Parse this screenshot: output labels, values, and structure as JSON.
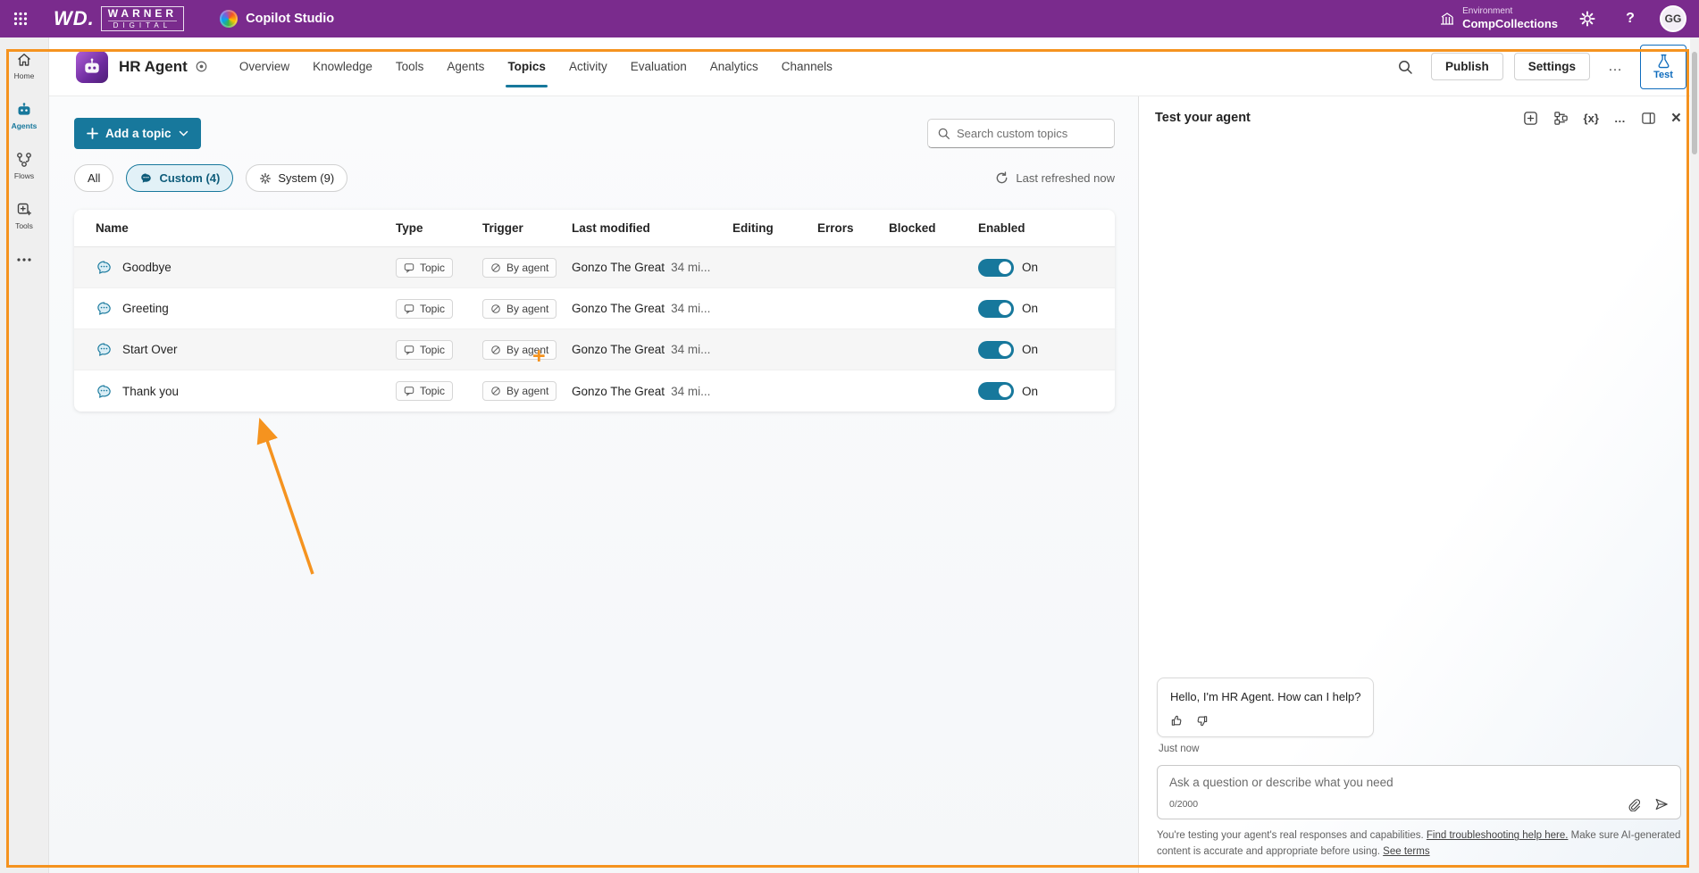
{
  "colors": {
    "topbar_purple": "#7a2b8d",
    "accent_teal": "#17789c",
    "action_blue": "#0f6cbd",
    "annotation_orange": "#f5931f"
  },
  "topbar": {
    "brand_wd": "WD.",
    "brand_warner": "WARNER",
    "brand_digital": "DIGITAL",
    "app_name": "Copilot Studio",
    "environment_label": "Environment",
    "environment_name": "CompCollections",
    "help_label": "?",
    "avatar_initials": "GG"
  },
  "rail": {
    "items": [
      {
        "label": "Home"
      },
      {
        "label": "Agents"
      },
      {
        "label": "Flows"
      },
      {
        "label": "Tools"
      }
    ]
  },
  "agent_header": {
    "title": "HR Agent",
    "tabs": [
      "Overview",
      "Knowledge",
      "Tools",
      "Agents",
      "Topics",
      "Activity",
      "Evaluation",
      "Analytics",
      "Channels"
    ],
    "active_tab": "Topics",
    "publish_label": "Publish",
    "settings_label": "Settings",
    "more_label": "…",
    "test_label": "Test"
  },
  "topics": {
    "add_button_label": "Add a topic",
    "search_placeholder": "Search custom topics",
    "filters": [
      {
        "label": "All"
      },
      {
        "label": "Custom (4)",
        "active": true
      },
      {
        "label": "System (9)"
      }
    ],
    "refresh_label": "Last refreshed now",
    "table": {
      "columns": [
        "Name",
        "Type",
        "Trigger",
        "Last modified",
        "Editing",
        "Errors",
        "Blocked",
        "Enabled"
      ],
      "rows": [
        {
          "name": "Goodbye",
          "type": "Topic",
          "trigger": "By agent",
          "modified_by": "Gonzo The Great",
          "modified_time": "34 mi...",
          "enabled": "On"
        },
        {
          "name": "Greeting",
          "type": "Topic",
          "trigger": "By agent",
          "modified_by": "Gonzo The Great",
          "modified_time": "34 mi...",
          "enabled": "On"
        },
        {
          "name": "Start Over",
          "type": "Topic",
          "trigger": "By agent",
          "modified_by": "Gonzo The Great",
          "modified_time": "34 mi...",
          "enabled": "On"
        },
        {
          "name": "Thank you",
          "type": "Topic",
          "trigger": "By agent",
          "modified_by": "Gonzo The Great",
          "modified_time": "34 mi...",
          "enabled": "On"
        }
      ]
    }
  },
  "test_panel": {
    "title": "Test your agent",
    "variables_label": "{x}",
    "more_label": "…",
    "close_label": "×",
    "message": "Hello, I'm HR Agent. How can I help?",
    "timestamp": "Just now",
    "input_placeholder": "Ask a question or describe what you need",
    "char_counter": "0/2000",
    "footer_text_1": "You're testing your agent's real responses and capabilities. ",
    "footer_link_1": "Find troubleshooting help here.",
    "footer_text_2": " Make sure AI-generated content is accurate and appropriate before using. ",
    "footer_link_2": "See terms"
  },
  "annotations": {
    "cursor_plus": "+"
  }
}
